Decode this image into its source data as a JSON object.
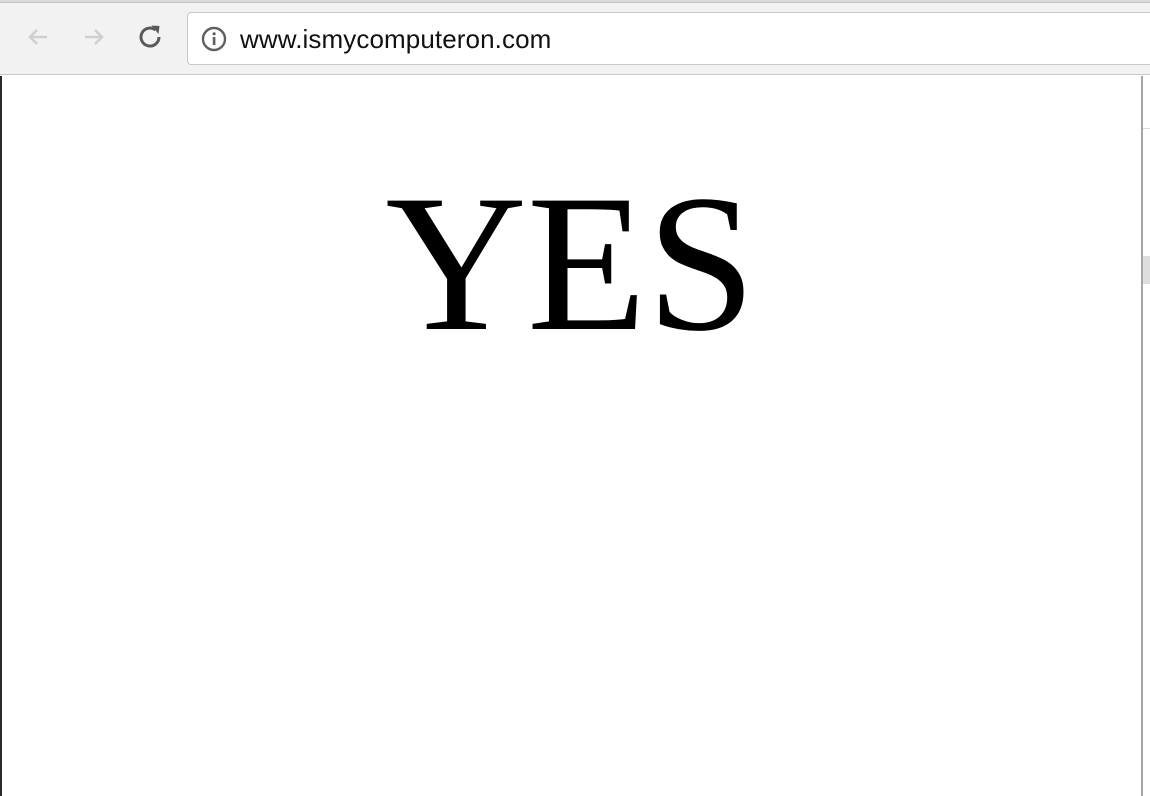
{
  "browser": {
    "address_bar": {
      "url": "www.ismycomputeron.com",
      "security_icon": "info-icon"
    },
    "navigation": {
      "back_icon": "arrow-left-icon",
      "forward_icon": "arrow-right-icon",
      "reload_icon": "reload-icon"
    }
  },
  "page": {
    "answer": "YES"
  },
  "colors": {
    "toolbar_background": "#f2f2f2",
    "page_background": "#ffffff",
    "text": "#000000",
    "disabled_nav_icon": "#c8c8c8",
    "active_nav_icon": "#5a5a5a"
  }
}
